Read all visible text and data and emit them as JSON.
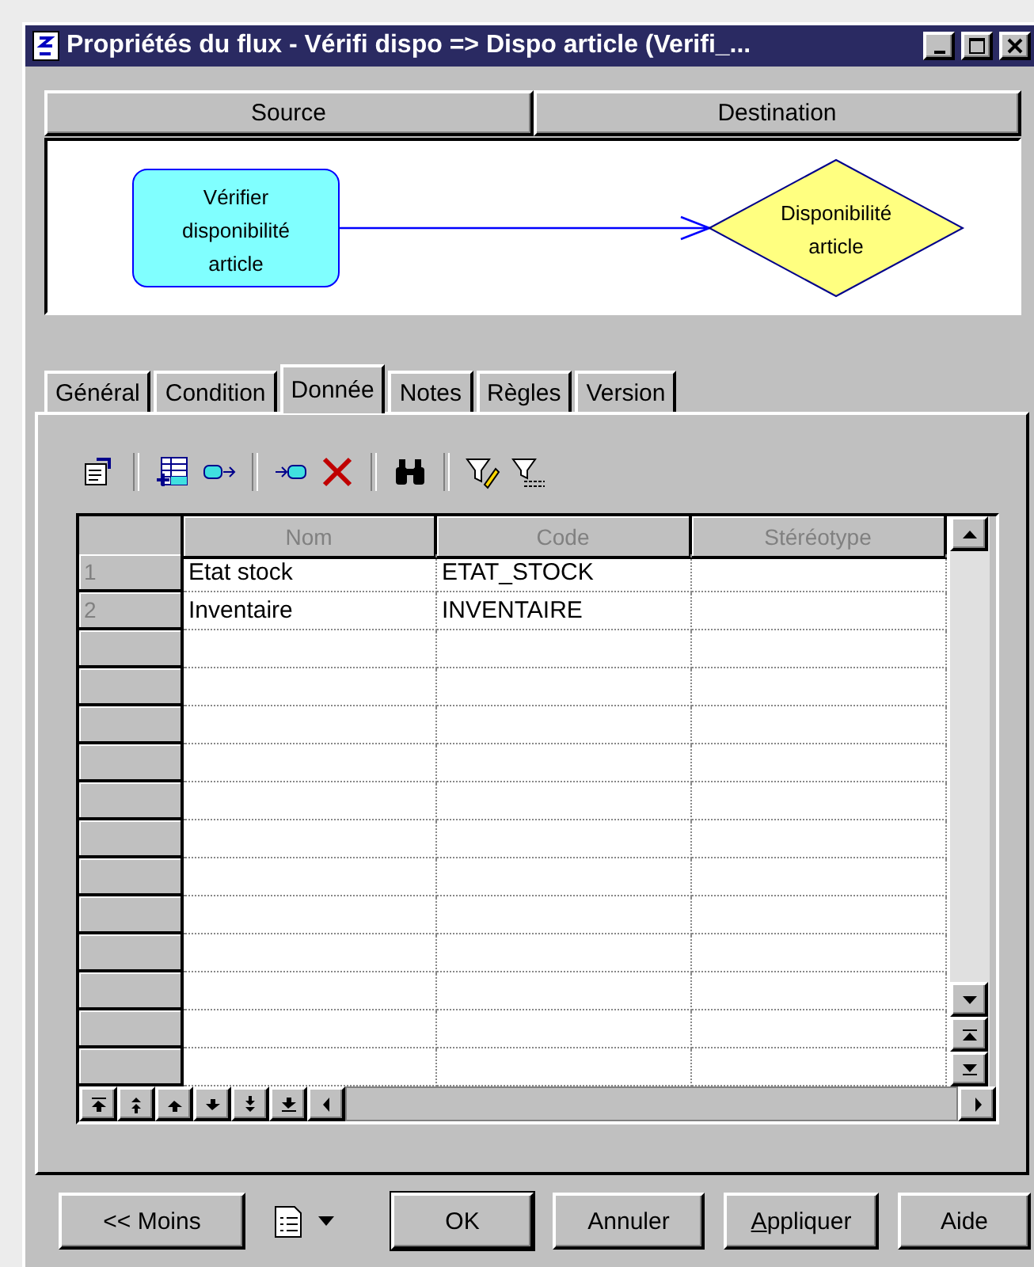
{
  "window": {
    "title": "Propriétés du flux - Vérifi dispo => Dispo article (Verifi_..."
  },
  "header_buttons": [
    "Source",
    "Destination"
  ],
  "diagram": {
    "source": "Vérifier disponibilité article",
    "destination": "Disponibilité article"
  },
  "tabs": [
    {
      "label": "Général",
      "selected": false
    },
    {
      "label": "Condition",
      "selected": false
    },
    {
      "label": "Donnée",
      "selected": true
    },
    {
      "label": "Notes",
      "selected": false
    },
    {
      "label": "Règles",
      "selected": false
    },
    {
      "label": "Version",
      "selected": false
    }
  ],
  "table": {
    "columns": [
      "Nom",
      "Code",
      "Stéréotype"
    ],
    "rows": [
      {
        "number": "1",
        "name": "Etat stock",
        "code": "ETAT_STOCK"
      },
      {
        "number": "2",
        "name": "Inventaire",
        "code": "INVENTAIRE"
      }
    ]
  },
  "buttons": [
    {
      "label": "<< Moins",
      "default": false,
      "mnemonic": false
    },
    {
      "label": "OK",
      "default": true,
      "mnemonic": false
    },
    {
      "label": "Annuler",
      "default": false,
      "mnemonic": false
    },
    {
      "label": "Appliquer",
      "default": false,
      "mnemonic": true
    },
    {
      "label": "Aide",
      "default": false,
      "mnemonic": false
    }
  ]
}
